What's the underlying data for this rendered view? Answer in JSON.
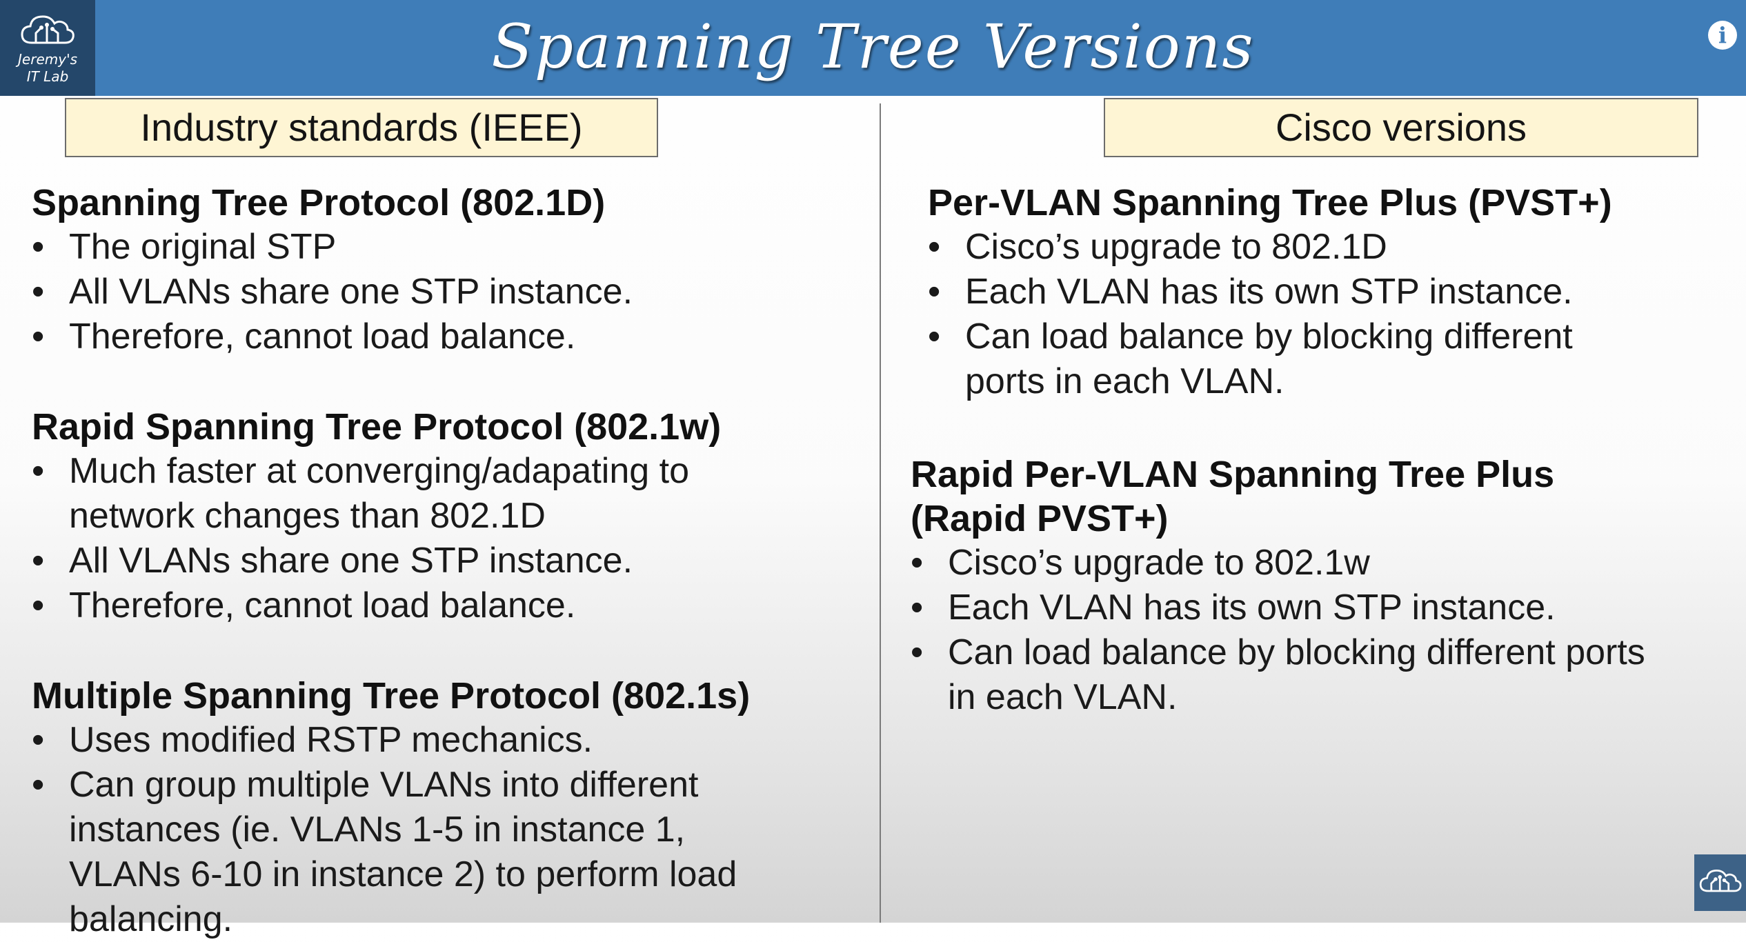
{
  "header": {
    "title": "Spanning Tree Versions",
    "logo_line1": "Jeremy's",
    "logo_line2": "IT Lab",
    "logo_icon": "cloud-circuit-icon",
    "info_icon": "info-icon",
    "info_glyph": "i",
    "accent_color": "#3f7db8"
  },
  "left": {
    "box_label": "Industry standards (IEEE)",
    "sections": [
      {
        "heading": "Spanning Tree Protocol (802.1D)",
        "bullets": [
          "The original STP",
          "All VLANs share one STP instance.",
          "Therefore, cannot load balance."
        ]
      },
      {
        "heading": "Rapid Spanning Tree Protocol (802.1w)",
        "bullets": [
          [
            "Much faster at converging/adapating to",
            "network changes than 802.1D"
          ],
          "All VLANs share one STP instance.",
          "Therefore, cannot load balance."
        ]
      },
      {
        "heading": "Multiple Spanning Tree Protocol (802.1s)",
        "bullets": [
          "Uses modified RSTP mechanics.",
          [
            "Can group multiple VLANs into different",
            "instances (ie. VLANs 1-5 in instance 1,",
            "VLANs 6-10 in instance 2) to perform load",
            "balancing."
          ]
        ]
      }
    ]
  },
  "right": {
    "box_label": "Cisco versions",
    "sections": [
      {
        "heading": "Per-VLAN Spanning Tree Plus (PVST+)",
        "bullets": [
          "Cisco’s upgrade to 802.1D",
          "Each VLAN has its own STP instance.",
          [
            "Can load balance by blocking different",
            "ports in each VLAN."
          ]
        ]
      },
      {
        "heading_lines": [
          "Rapid Per-VLAN Spanning Tree Plus",
          "(Rapid PVST+)"
        ],
        "bullets": [
          "Cisco’s upgrade to 802.1w",
          "Each VLAN has its own STP instance.",
          [
            "Can load balance by blocking different ports",
            "in each VLAN."
          ]
        ]
      }
    ]
  },
  "bullet_glyph": "•",
  "corner_icon": "cloud-circuit-icon"
}
